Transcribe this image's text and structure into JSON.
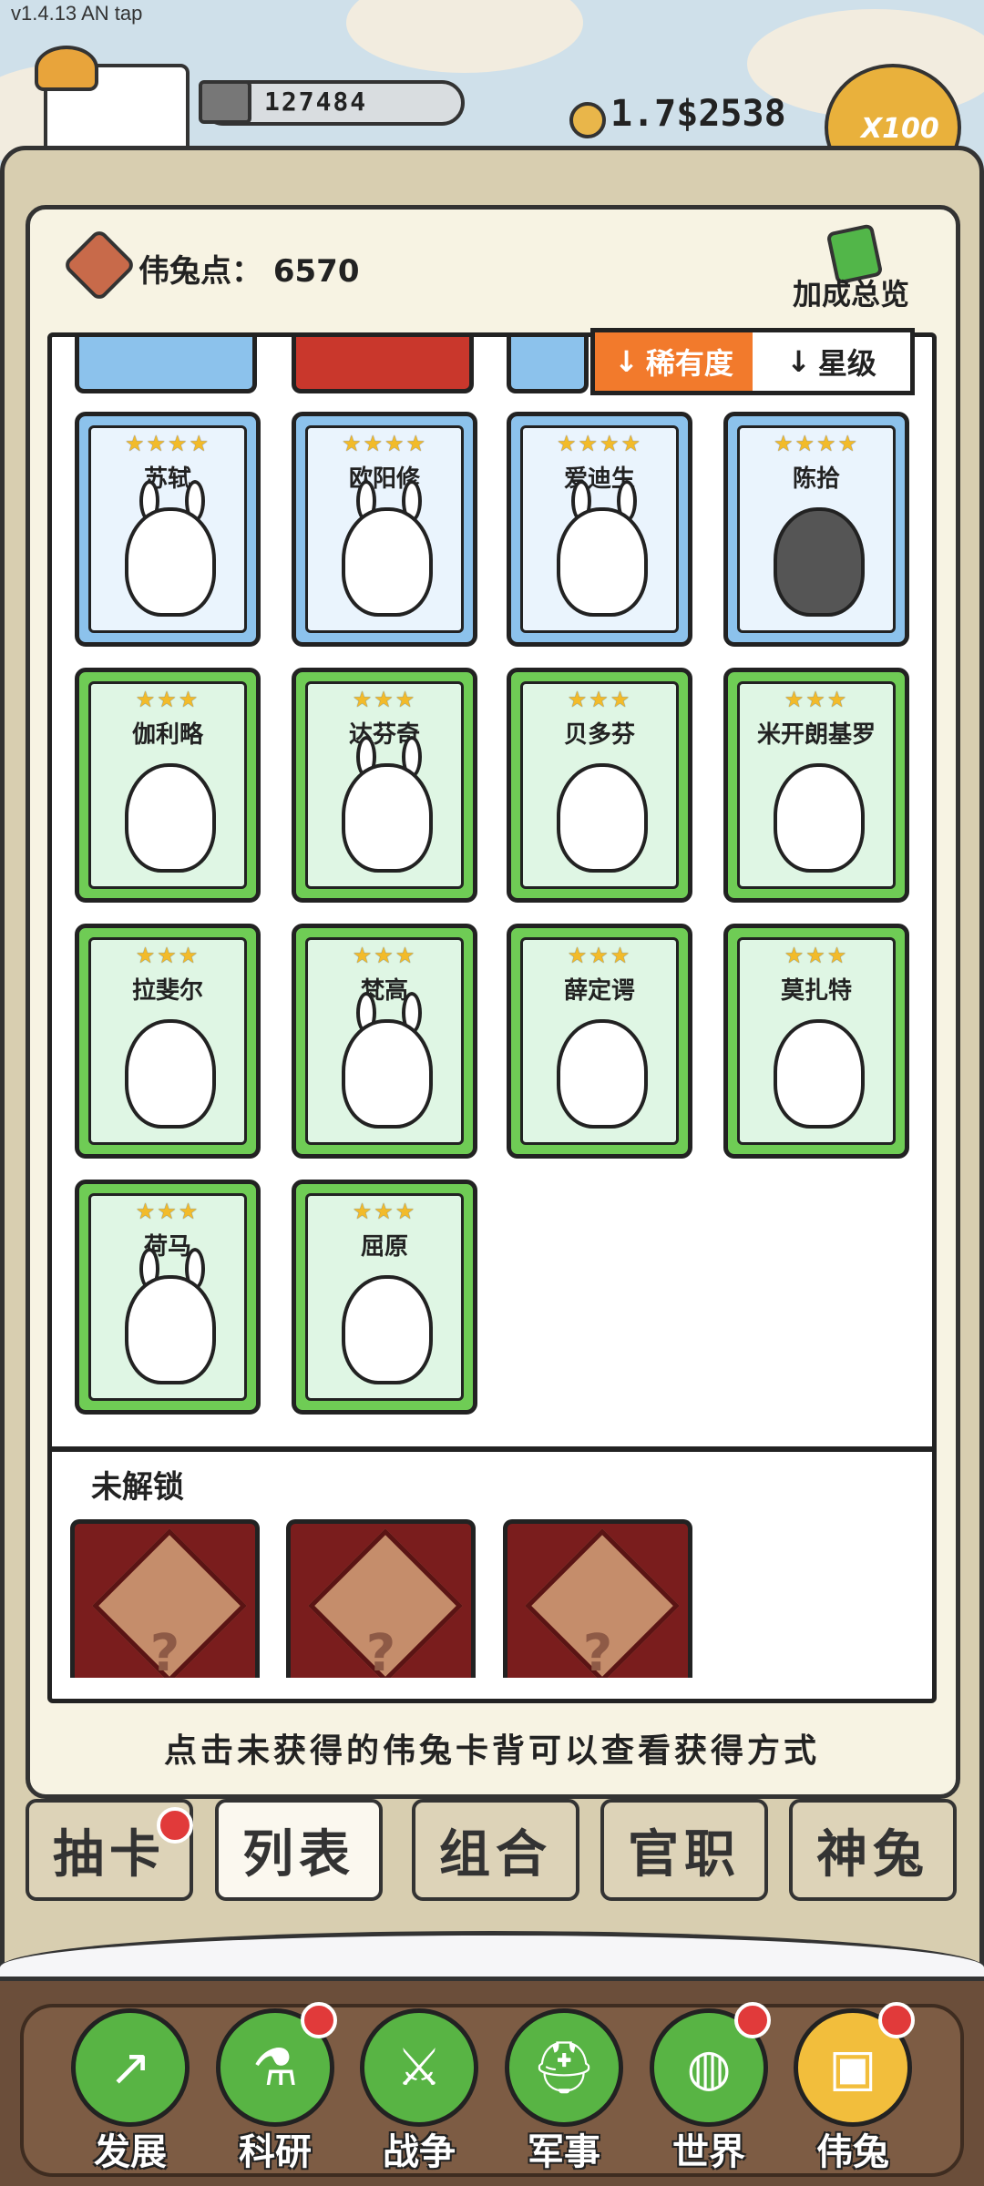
{
  "hud": {
    "version": "v1.4.13 AN tap",
    "silver": "127484",
    "gold": "1.7$2538",
    "multiplier": "X100"
  },
  "panel": {
    "points_label": "伟兔点：",
    "points_value": "6570",
    "bonus_overview": "加成总览"
  },
  "sort": {
    "rarity_label": "稀有度",
    "level_label": "星级",
    "arrow": "↓"
  },
  "cards": [
    {
      "name": "苏轼",
      "stars": "★★★★",
      "rarity": "blue"
    },
    {
      "name": "欧阳修",
      "stars": "★★★★",
      "rarity": "blue"
    },
    {
      "name": "爱迪生",
      "stars": "★★★★",
      "rarity": "blue"
    },
    {
      "name": "陈拾",
      "stars": "★★★★",
      "rarity": "blue"
    },
    {
      "name": "伽利略",
      "stars": "★★★",
      "rarity": "green"
    },
    {
      "name": "达芬奇",
      "stars": "★★★",
      "rarity": "green"
    },
    {
      "name": "贝多芬",
      "stars": "★★★",
      "rarity": "green"
    },
    {
      "name": "米开朗基罗",
      "stars": "★★★",
      "rarity": "green"
    },
    {
      "name": "拉斐尔",
      "stars": "★★★",
      "rarity": "green"
    },
    {
      "name": "梵高",
      "stars": "★★★",
      "rarity": "green"
    },
    {
      "name": "薛定谔",
      "stars": "★★★",
      "rarity": "green"
    },
    {
      "name": "莫扎特",
      "stars": "★★★",
      "rarity": "green"
    },
    {
      "name": "荷马",
      "stars": "★★★",
      "rarity": "green"
    },
    {
      "name": "屈原",
      "stars": "★★★",
      "rarity": "green"
    }
  ],
  "locked": {
    "label": "未解锁",
    "question": "?"
  },
  "hint": "点击未获得的伟兔卡背可以查看获得方式",
  "tabs": [
    {
      "label": "抽卡"
    },
    {
      "label": "列表"
    },
    {
      "label": "组合"
    },
    {
      "label": "官职"
    },
    {
      "label": "神兔"
    }
  ],
  "nav": [
    {
      "label": "发展",
      "icon": "growth-arrow-icon"
    },
    {
      "label": "科研",
      "icon": "flask-icon"
    },
    {
      "label": "战争",
      "icon": "crossed-swords-icon"
    },
    {
      "label": "军事",
      "icon": "helmet-icon"
    },
    {
      "label": "世界",
      "icon": "globe-icon"
    },
    {
      "label": "伟兔",
      "icon": "rabbit-card-icon"
    }
  ],
  "colors": {
    "accent": "#f27a2c",
    "blue_card": "#8cc2ec",
    "green_card": "#6fcc55",
    "notification": "#e13a3a"
  }
}
